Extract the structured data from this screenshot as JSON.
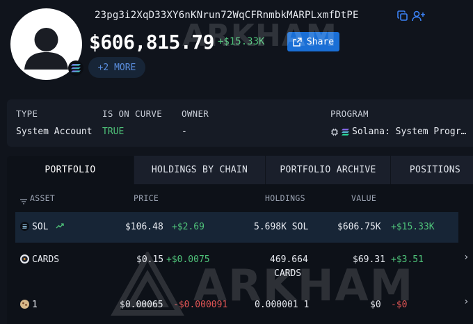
{
  "entity": {
    "address": "23pg3i2XqD33XY6nKNrun72WqCFRnmbkMARPLxmfDtPE",
    "total_value": "$606,815.79",
    "total_change": "+$15.33K",
    "share_label": "Share",
    "more_label": "+2 MORE",
    "chain_icon": "solana-icon"
  },
  "info": {
    "type_label": "TYPE",
    "type_value": "System Account",
    "curve_label": "IS ON CURVE",
    "curve_value": "TRUE",
    "owner_label": "OWNER",
    "owner_value": "-",
    "program_label": "PROGRAM",
    "program_value": "Solana: System Progr…"
  },
  "tabs": [
    {
      "label": "PORTFOLIO",
      "active": true
    },
    {
      "label": "HOLDINGS BY CHAIN",
      "active": false
    },
    {
      "label": "PORTFOLIO ARCHIVE",
      "active": false
    },
    {
      "label": "POSITIONS",
      "active": false
    }
  ],
  "columns": {
    "asset": "ASSET",
    "price": "PRICE",
    "holdings": "HOLDINGS",
    "value": "VALUE"
  },
  "rows": [
    {
      "asset": "SOL",
      "price": "$106.48",
      "price_change": "+$2.69",
      "holdings": "5.698K SOL",
      "value": "$606.75K",
      "value_change": "+$15.33K"
    },
    {
      "asset": "CARDS",
      "price": "$0.15",
      "price_change": "+$0.0075",
      "holdings": "469.664",
      "holdings_unit": "CARDS",
      "value": "$69.31",
      "value_change": "+$3.51"
    },
    {
      "asset": "1",
      "price": "$0.00065",
      "price_change": "-$0.000091",
      "holdings": "0.000001 1",
      "value": "$0",
      "value_change": "-$0"
    }
  ],
  "watermark": "ARKHAM",
  "colors": {
    "accent": "#1a6fd6",
    "positive": "#4fc47a",
    "negative": "#e25555",
    "background": "#10141c"
  }
}
